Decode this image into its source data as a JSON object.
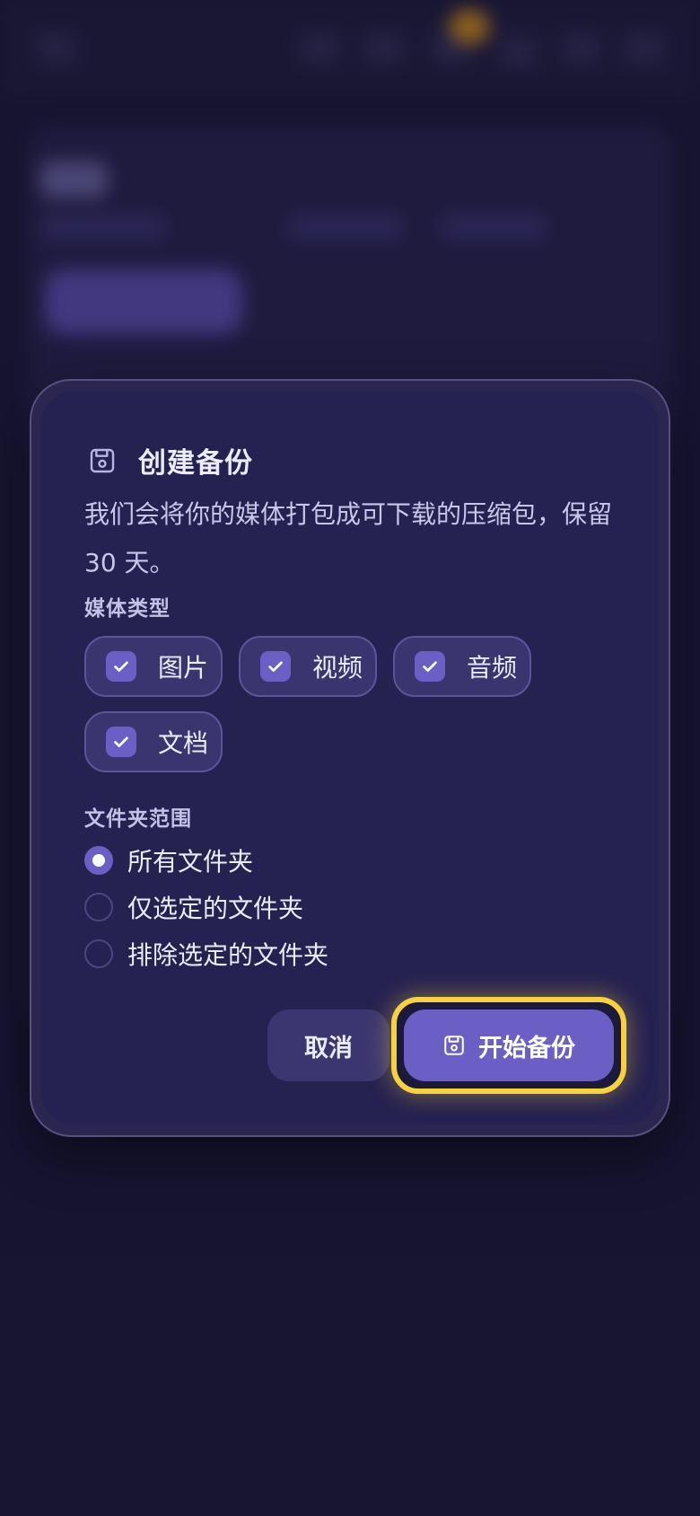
{
  "dialog": {
    "title": "创建备份",
    "description": "我们会将你的媒体打包成可下载的压缩包，保留 30 天。",
    "media_types": {
      "label": "媒体类型",
      "options": [
        {
          "label": "图片",
          "checked": true
        },
        {
          "label": "视频",
          "checked": true
        },
        {
          "label": "音频",
          "checked": true
        },
        {
          "label": "文档",
          "checked": true
        }
      ]
    },
    "folder_scope": {
      "label": "文件夹范围",
      "options": [
        {
          "label": "所有文件夹",
          "selected": true
        },
        {
          "label": "仅选定的文件夹",
          "selected": false
        },
        {
          "label": "排除选定的文件夹",
          "selected": false
        }
      ]
    },
    "cancel_label": "取消",
    "start_label": "开始备份",
    "icons": {
      "title": "save-icon",
      "start": "save-icon",
      "check": "check-icon"
    }
  },
  "colors": {
    "accent": "#6b5fc6",
    "focus": "#f7d23e",
    "background": "#1a1836",
    "panel": "#252150"
  }
}
